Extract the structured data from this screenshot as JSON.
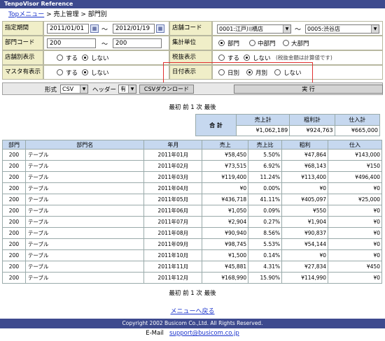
{
  "app": {
    "title": "TenpoVisor Reference"
  },
  "breadcrumb": {
    "home": "Topメニュー",
    "sep1": " > ",
    "section": "売上管理",
    "sep2": " > ",
    "page": "部門別"
  },
  "form": {
    "period": {
      "label": "指定期間",
      "from": "2011/01/01",
      "tilde": "〜",
      "to": "2012/01/19"
    },
    "store_code": {
      "label": "店舗コード",
      "from": "0001:江戸川橋店",
      "tilde": "〜",
      "to": "0005:渋谷店"
    },
    "dept_code": {
      "label": "部門コード",
      "from": "200",
      "tilde": "〜",
      "to": "200"
    },
    "aggregate_unit": {
      "label": "集計単位",
      "options": [
        "部門",
        "中部門",
        "大部門"
      ],
      "selected": 0
    },
    "store_display": {
      "label": "店舗別表示",
      "options": [
        "する",
        "しない"
      ],
      "selected": 1
    },
    "tax_display": {
      "label": "税抜表示",
      "options": [
        "する",
        "しない"
      ],
      "note": "(税抜金額は計算値です)",
      "selected": 1
    },
    "master_display": {
      "label": "マスタ有表示",
      "options": [
        "する",
        "しない"
      ],
      "selected": 1
    },
    "date_display": {
      "label": "日付表示",
      "options": [
        "日別",
        "月別",
        "しない"
      ],
      "selected": 1
    }
  },
  "toolbar": {
    "format_label": "形式",
    "format_value": "CSV",
    "header_label": "ヘッダー",
    "header_value": "有",
    "csv_button": "CSVダウンロード",
    "run_button": "実 行"
  },
  "pager": {
    "text": "最初 前 1 次 最後"
  },
  "totals": {
    "label": "合 計",
    "headers": [
      "売上計",
      "粗利計",
      "仕入計"
    ],
    "values": [
      "¥1,062,189",
      "¥924,763",
      "¥665,000"
    ]
  },
  "grid": {
    "headers": [
      "部門",
      "部門名",
      "年月",
      "売上",
      "売上比",
      "粗利",
      "仕入"
    ],
    "rows": [
      [
        "200",
        "テーブル",
        "2011年01月",
        "¥58,450",
        "5.50%",
        "¥47,864",
        "¥143,000"
      ],
      [
        "200",
        "テーブル",
        "2011年02月",
        "¥73,515",
        "6.92%",
        "¥68,143",
        "¥150"
      ],
      [
        "200",
        "テーブル",
        "2011年03月",
        "¥119,400",
        "11.24%",
        "¥113,400",
        "¥496,400"
      ],
      [
        "200",
        "テーブル",
        "2011年04月",
        "¥0",
        "0.00%",
        "¥0",
        "¥0"
      ],
      [
        "200",
        "テーブル",
        "2011年05月",
        "¥436,718",
        "41.11%",
        "¥405,097",
        "¥25,000"
      ],
      [
        "200",
        "テーブル",
        "2011年06月",
        "¥1,050",
        "0.09%",
        "¥550",
        "¥0"
      ],
      [
        "200",
        "テーブル",
        "2011年07月",
        "¥2,904",
        "0.27%",
        "¥1,904",
        "¥0"
      ],
      [
        "200",
        "テーブル",
        "2011年08月",
        "¥90,940",
        "8.56%",
        "¥90,837",
        "¥0"
      ],
      [
        "200",
        "テーブル",
        "2011年09月",
        "¥98,745",
        "5.53%",
        "¥54,144",
        "¥0"
      ],
      [
        "200",
        "テーブル",
        "2011年10月",
        "¥1,500",
        "0.14%",
        "¥0",
        "¥0"
      ],
      [
        "200",
        "テーブル",
        "2011年11月",
        "¥45,881",
        "4.31%",
        "¥27,834",
        "¥450"
      ],
      [
        "200",
        "テーブル",
        "2011年12月",
        "¥168,990",
        "15.90%",
        "¥114,990",
        "¥0"
      ]
    ]
  },
  "back_link": "メニューへ戻る",
  "footer": {
    "copyright": "Copyright 2002 Busicom Co.,Ltd. All Rights Reserved.",
    "email_label": "E-Mail",
    "email": "support@busicom.co.jp"
  }
}
